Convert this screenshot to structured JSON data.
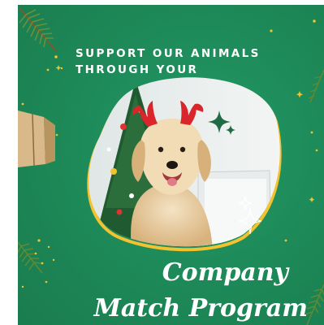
{
  "headline": {
    "line1": "SUPPORT OUR ANIMALS",
    "line2": "THROUGH YOUR"
  },
  "title": {
    "line1": "Company",
    "line2": "Match Program"
  },
  "colors": {
    "background": "#1f8a5a",
    "accent_gold": "#f2c230",
    "text": "#ffffff",
    "sparkle": "#d6f5e4"
  },
  "icons": [
    "sparkle-icon",
    "star-icon",
    "pine-branch-icon",
    "gift-box-icon",
    "reindeer-antlers-icon"
  ]
}
